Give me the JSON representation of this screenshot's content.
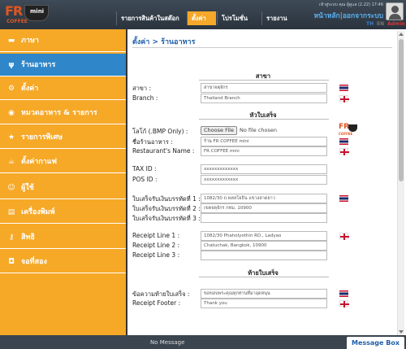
{
  "header": {
    "logo": {
      "fr": "FR",
      "mini": "mini",
      "coffee": "COFFEE"
    },
    "nav": [
      "รายการสินค้าในสต๊อก",
      "ตั้งค่า",
      "โปรโมชั่น",
      "รายงาน"
    ],
    "active_nav": 1,
    "user_info": "เข้าสู่ระบบ คุณ ผู้ดูแล (2.22) 17:46",
    "home_link": "หน้าหลัก",
    "separator": "|",
    "logout_link": "ออกจากระบบ",
    "langs": {
      "th": "TH",
      "en": "EN",
      "admin": "Admin"
    }
  },
  "sidebar": {
    "items": [
      {
        "label": "ภาษา",
        "icon": "thai-flag-icon",
        "glyph": "▬"
      },
      {
        "label": "ร้านอาหาร",
        "icon": "restaurant-icon",
        "glyph": "ψ"
      },
      {
        "label": "ตั้งค่า",
        "icon": "gear-icon",
        "glyph": "⚙"
      },
      {
        "label": "หมวดอาหาร & รายการ",
        "icon": "plate-icon",
        "glyph": "◉"
      },
      {
        "label": "รายการพิเศษ",
        "icon": "star-icon",
        "glyph": "★"
      },
      {
        "label": "ตั้งค่ากาแฟ",
        "icon": "coffee-cup-icon",
        "glyph": "☕"
      },
      {
        "label": "ผู้ใช้",
        "icon": "users-icon",
        "glyph": "☺"
      },
      {
        "label": "เครื่องพิมพ์",
        "icon": "printer-icon",
        "glyph": "▤"
      },
      {
        "label": "สิทธิ",
        "icon": "key-icon",
        "glyph": "⚷"
      },
      {
        "label": "จอที่สอง",
        "icon": "monitor-icon",
        "glyph": "◘"
      }
    ],
    "active_index": 1
  },
  "main": {
    "breadcrumb": "ตั้งค่า > ร้านอาหาร",
    "sections": {
      "branch": "สาขา",
      "receipt_header": "หัวใบเสร็จ",
      "receipt_footer": "ท้ายใบเสร็จ"
    },
    "fields": {
      "branch_th": {
        "label": "สาขา :",
        "value": "สาขาจตุจักร"
      },
      "branch_en": {
        "label": "Branch :",
        "value": "Thailand Branch"
      },
      "logo": {
        "label": "โลโก้ (.BMP Only) :",
        "button": "Choose File",
        "filename": "No file chosen"
      },
      "name_th": {
        "label": "ชื่อร้านอาหาร :",
        "value": "ร้าน FR COFFEE mini"
      },
      "name_en": {
        "label": "Restaurant's Name :",
        "value": "FR COFFEE mini"
      },
      "tax_id": {
        "label": "TAX ID :",
        "value": "xxxxxxxxxxxxx"
      },
      "pos_id": {
        "label": "POS ID :",
        "value": "xxxxxxxxxxxxx"
      },
      "receipt_th_1": {
        "label": "ใบเสร็จรับเงินบรรทัดที่ 1 :",
        "value": "1082/30 ถ.พหลโยธิน แขวงลาดยาว"
      },
      "receipt_th_2": {
        "label": "ใบเสร็จรับเงินบรรทัดที่ 2 :",
        "value": "เขตจตุจักร กทม. 10900"
      },
      "receipt_th_3": {
        "label": "ใบเสร็จรับเงินบรรทัดที่ 3 :",
        "value": ""
      },
      "receipt_en_1": {
        "label": "Receipt Line 1 :",
        "value": "1082/30 Phaholyothin RD., Ladyao"
      },
      "receipt_en_2": {
        "label": "Receipt Line 2 :",
        "value": "Chatuchak, Bangkok, 10900"
      },
      "receipt_en_3": {
        "label": "Receipt Line 3 :",
        "value": ""
      },
      "footer_th": {
        "label": "ข้อความท้ายใบเสร็จ :",
        "value": "ขอขอบพระคุณทุกท่านที่มาอุดหนุน"
      },
      "footer_en": {
        "label": "Receipt Footer :",
        "value": "Thank you"
      }
    }
  },
  "footer": {
    "status": "No Message",
    "message_box": "Message Box"
  },
  "colors": {
    "sidebar": "#f6a827",
    "sidebar_active": "#2f86c9",
    "header": "#2f3a45",
    "accent_link": "#5ab0f0"
  }
}
